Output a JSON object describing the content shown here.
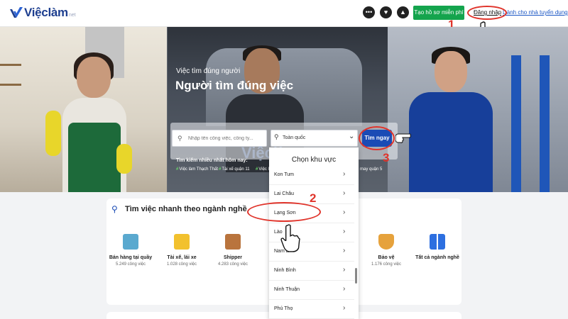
{
  "header": {
    "logo_text": "Việclàm",
    "logo_suffix": "net",
    "icons": [
      "chat-icon",
      "heart-icon",
      "bell-icon"
    ],
    "create_profile_label": "Tạo hồ sơ miễn phí",
    "login_label": "Đăng nhập",
    "employer_label": "Dành cho nhà tuyển dụng",
    "accent_color": "#14a44d",
    "brand_color": "#1d3e8f"
  },
  "hero": {
    "subtitle": "Việc tìm đúng người",
    "title": "Người tìm đúng việc",
    "search": {
      "keyword_placeholder": "Nhập tên công việc, công ty...",
      "location_value": "Toàn quốc",
      "button_label": "Tìm ngay"
    },
    "trending": {
      "label": "Tìm kiếm nhiều nhất hôm nay:",
      "items": [
        "Việc làm Thạch Thất",
        "Tài xế quận 11",
        "Việc là"
      ],
      "right_text": "may quận 5"
    },
    "watermark": "Việclàm"
  },
  "location_dropdown": {
    "title": "Chọn khu vực",
    "items": [
      "Kon Tum",
      "Lai Châu",
      "Lạng Sơn",
      "Lào",
      "Nam Đ",
      "Ninh Bình",
      "Ninh Thuận",
      "Phú Thọ"
    ]
  },
  "categories": {
    "title": "Tìm việc nhanh theo ngành nghề",
    "items": [
      {
        "name": "Bán hàng tại quầy",
        "count": "5.249 công việc",
        "icon": "store-counter-icon"
      },
      {
        "name": "Tài xế, lái xe",
        "count": "1.028 công việc",
        "icon": "taxi-icon"
      },
      {
        "name": "Shipper",
        "count": "4.283 công việc",
        "icon": "package-icon"
      },
      {
        "name": "Bảo vệ",
        "count": "1.176 công việc",
        "icon": "security-shield-icon"
      },
      {
        "name": "Tất cả ngành nghề",
        "count": "",
        "icon": "grid-icon"
      }
    ]
  },
  "annotations": {
    "step1": "1",
    "step2": "2",
    "step3": "3",
    "color": "#e0342b"
  }
}
